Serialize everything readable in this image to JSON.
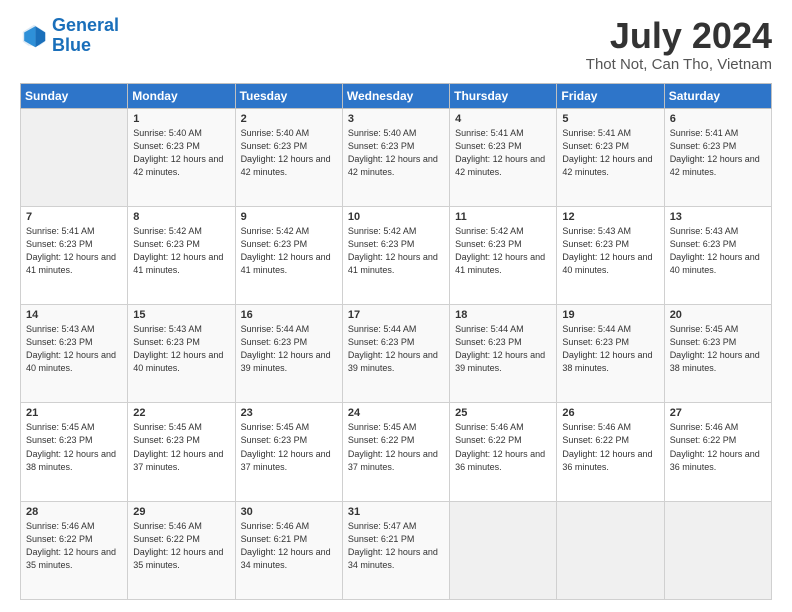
{
  "header": {
    "logo_general": "General",
    "logo_blue": "Blue",
    "month_year": "July 2024",
    "location": "Thot Not, Can Tho, Vietnam"
  },
  "days_of_week": [
    "Sunday",
    "Monday",
    "Tuesday",
    "Wednesday",
    "Thursday",
    "Friday",
    "Saturday"
  ],
  "weeks": [
    [
      {
        "day": "",
        "sunrise": "",
        "sunset": "",
        "daylight": ""
      },
      {
        "day": "1",
        "sunrise": "Sunrise: 5:40 AM",
        "sunset": "Sunset: 6:23 PM",
        "daylight": "Daylight: 12 hours and 42 minutes."
      },
      {
        "day": "2",
        "sunrise": "Sunrise: 5:40 AM",
        "sunset": "Sunset: 6:23 PM",
        "daylight": "Daylight: 12 hours and 42 minutes."
      },
      {
        "day": "3",
        "sunrise": "Sunrise: 5:40 AM",
        "sunset": "Sunset: 6:23 PM",
        "daylight": "Daylight: 12 hours and 42 minutes."
      },
      {
        "day": "4",
        "sunrise": "Sunrise: 5:41 AM",
        "sunset": "Sunset: 6:23 PM",
        "daylight": "Daylight: 12 hours and 42 minutes."
      },
      {
        "day": "5",
        "sunrise": "Sunrise: 5:41 AM",
        "sunset": "Sunset: 6:23 PM",
        "daylight": "Daylight: 12 hours and 42 minutes."
      },
      {
        "day": "6",
        "sunrise": "Sunrise: 5:41 AM",
        "sunset": "Sunset: 6:23 PM",
        "daylight": "Daylight: 12 hours and 42 minutes."
      }
    ],
    [
      {
        "day": "7",
        "sunrise": "Sunrise: 5:41 AM",
        "sunset": "Sunset: 6:23 PM",
        "daylight": "Daylight: 12 hours and 41 minutes."
      },
      {
        "day": "8",
        "sunrise": "Sunrise: 5:42 AM",
        "sunset": "Sunset: 6:23 PM",
        "daylight": "Daylight: 12 hours and 41 minutes."
      },
      {
        "day": "9",
        "sunrise": "Sunrise: 5:42 AM",
        "sunset": "Sunset: 6:23 PM",
        "daylight": "Daylight: 12 hours and 41 minutes."
      },
      {
        "day": "10",
        "sunrise": "Sunrise: 5:42 AM",
        "sunset": "Sunset: 6:23 PM",
        "daylight": "Daylight: 12 hours and 41 minutes."
      },
      {
        "day": "11",
        "sunrise": "Sunrise: 5:42 AM",
        "sunset": "Sunset: 6:23 PM",
        "daylight": "Daylight: 12 hours and 41 minutes."
      },
      {
        "day": "12",
        "sunrise": "Sunrise: 5:43 AM",
        "sunset": "Sunset: 6:23 PM",
        "daylight": "Daylight: 12 hours and 40 minutes."
      },
      {
        "day": "13",
        "sunrise": "Sunrise: 5:43 AM",
        "sunset": "Sunset: 6:23 PM",
        "daylight": "Daylight: 12 hours and 40 minutes."
      }
    ],
    [
      {
        "day": "14",
        "sunrise": "Sunrise: 5:43 AM",
        "sunset": "Sunset: 6:23 PM",
        "daylight": "Daylight: 12 hours and 40 minutes."
      },
      {
        "day": "15",
        "sunrise": "Sunrise: 5:43 AM",
        "sunset": "Sunset: 6:23 PM",
        "daylight": "Daylight: 12 hours and 40 minutes."
      },
      {
        "day": "16",
        "sunrise": "Sunrise: 5:44 AM",
        "sunset": "Sunset: 6:23 PM",
        "daylight": "Daylight: 12 hours and 39 minutes."
      },
      {
        "day": "17",
        "sunrise": "Sunrise: 5:44 AM",
        "sunset": "Sunset: 6:23 PM",
        "daylight": "Daylight: 12 hours and 39 minutes."
      },
      {
        "day": "18",
        "sunrise": "Sunrise: 5:44 AM",
        "sunset": "Sunset: 6:23 PM",
        "daylight": "Daylight: 12 hours and 39 minutes."
      },
      {
        "day": "19",
        "sunrise": "Sunrise: 5:44 AM",
        "sunset": "Sunset: 6:23 PM",
        "daylight": "Daylight: 12 hours and 38 minutes."
      },
      {
        "day": "20",
        "sunrise": "Sunrise: 5:45 AM",
        "sunset": "Sunset: 6:23 PM",
        "daylight": "Daylight: 12 hours and 38 minutes."
      }
    ],
    [
      {
        "day": "21",
        "sunrise": "Sunrise: 5:45 AM",
        "sunset": "Sunset: 6:23 PM",
        "daylight": "Daylight: 12 hours and 38 minutes."
      },
      {
        "day": "22",
        "sunrise": "Sunrise: 5:45 AM",
        "sunset": "Sunset: 6:23 PM",
        "daylight": "Daylight: 12 hours and 37 minutes."
      },
      {
        "day": "23",
        "sunrise": "Sunrise: 5:45 AM",
        "sunset": "Sunset: 6:23 PM",
        "daylight": "Daylight: 12 hours and 37 minutes."
      },
      {
        "day": "24",
        "sunrise": "Sunrise: 5:45 AM",
        "sunset": "Sunset: 6:22 PM",
        "daylight": "Daylight: 12 hours and 37 minutes."
      },
      {
        "day": "25",
        "sunrise": "Sunrise: 5:46 AM",
        "sunset": "Sunset: 6:22 PM",
        "daylight": "Daylight: 12 hours and 36 minutes."
      },
      {
        "day": "26",
        "sunrise": "Sunrise: 5:46 AM",
        "sunset": "Sunset: 6:22 PM",
        "daylight": "Daylight: 12 hours and 36 minutes."
      },
      {
        "day": "27",
        "sunrise": "Sunrise: 5:46 AM",
        "sunset": "Sunset: 6:22 PM",
        "daylight": "Daylight: 12 hours and 36 minutes."
      }
    ],
    [
      {
        "day": "28",
        "sunrise": "Sunrise: 5:46 AM",
        "sunset": "Sunset: 6:22 PM",
        "daylight": "Daylight: 12 hours and 35 minutes."
      },
      {
        "day": "29",
        "sunrise": "Sunrise: 5:46 AM",
        "sunset": "Sunset: 6:22 PM",
        "daylight": "Daylight: 12 hours and 35 minutes."
      },
      {
        "day": "30",
        "sunrise": "Sunrise: 5:46 AM",
        "sunset": "Sunset: 6:21 PM",
        "daylight": "Daylight: 12 hours and 34 minutes."
      },
      {
        "day": "31",
        "sunrise": "Sunrise: 5:47 AM",
        "sunset": "Sunset: 6:21 PM",
        "daylight": "Daylight: 12 hours and 34 minutes."
      },
      {
        "day": "",
        "sunrise": "",
        "sunset": "",
        "daylight": ""
      },
      {
        "day": "",
        "sunrise": "",
        "sunset": "",
        "daylight": ""
      },
      {
        "day": "",
        "sunrise": "",
        "sunset": "",
        "daylight": ""
      }
    ]
  ]
}
